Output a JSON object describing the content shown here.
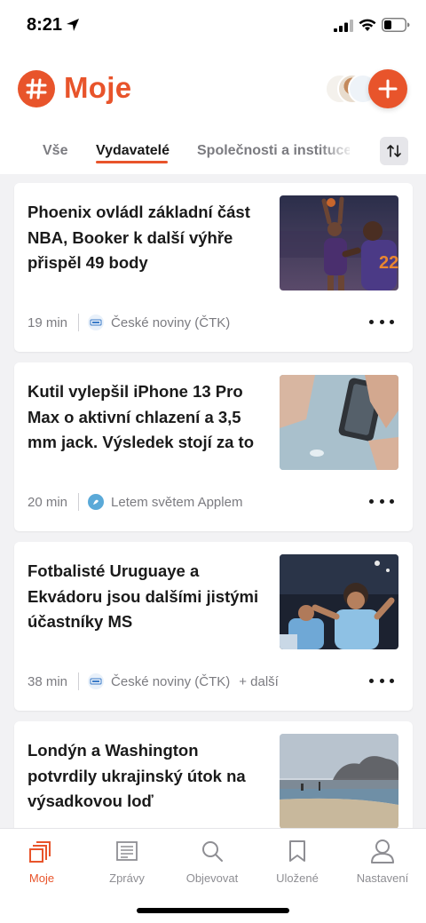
{
  "status_bar": {
    "time": "8:21"
  },
  "header": {
    "title": "Moje",
    "add_button_label": "+"
  },
  "tabs": [
    {
      "label": "Vše",
      "active": false
    },
    {
      "label": "Vydavatelé",
      "active": true
    },
    {
      "label": "Společnosti a instituce",
      "active": false
    }
  ],
  "accent_color": "#e8542b",
  "articles": [
    {
      "title": "Phoenix ovládl základní část NBA, Booker k další výhře přispěl 49 body",
      "age": "19 min",
      "source": "České noviny (ČTK)",
      "extra": ""
    },
    {
      "title": "Kutil vylepšil iPhone 13 Pro Max o aktivní chlazení a 3,5 mm jack. Výsledek stojí za to",
      "age": "20 min",
      "source": "Letem světem Applem",
      "extra": ""
    },
    {
      "title": "Fotbalisté Uruguaye a Ekvádoru jsou dalšími jistými účastníky MS",
      "age": "38 min",
      "source": "České noviny (ČTK)",
      "extra": "+ další"
    },
    {
      "title": "Londýn a Washington potvrdily ukrajinský útok na výsadkovou loď",
      "age": "",
      "source": "",
      "extra": ""
    }
  ],
  "bottom_nav": [
    {
      "label": "Moje",
      "icon": "my-feed-icon",
      "active": true
    },
    {
      "label": "Zprávy",
      "icon": "news-icon",
      "active": false
    },
    {
      "label": "Objevovat",
      "icon": "search-icon",
      "active": false
    },
    {
      "label": "Uložené",
      "icon": "bookmark-icon",
      "active": false
    },
    {
      "label": "Nastavení",
      "icon": "profile-icon",
      "active": false
    }
  ]
}
